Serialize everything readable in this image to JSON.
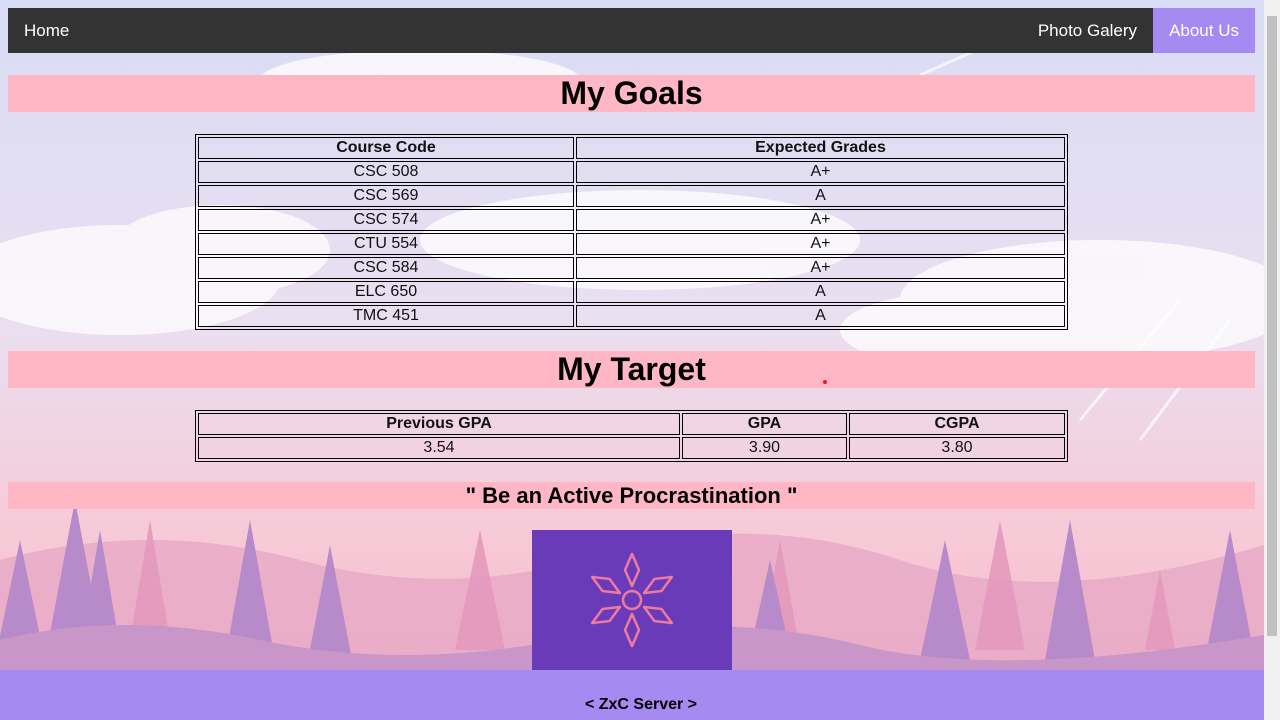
{
  "nav": {
    "home": "Home",
    "gallery": "Photo Galery",
    "about": "About Us"
  },
  "goals": {
    "title": "My Goals",
    "headers": [
      "Course Code",
      "Expected Grades"
    ],
    "rows": [
      [
        "CSC 508",
        "A+"
      ],
      [
        "CSC 569",
        "A"
      ],
      [
        "CSC 574",
        "A+"
      ],
      [
        "CTU 554",
        "A+"
      ],
      [
        "CSC 584",
        "A+"
      ],
      [
        "ELC 650",
        "A"
      ],
      [
        "TMC 451",
        "A"
      ]
    ]
  },
  "target": {
    "title": "My Target",
    "headers": [
      "Previous GPA",
      "GPA",
      "CGPA"
    ],
    "rows": [
      [
        "3.54",
        "3.90",
        "3.80"
      ]
    ]
  },
  "quote": "\" Be an Active Procrastination \"",
  "footer": {
    "text": "< ZxC Server >"
  },
  "colors": {
    "navbar": "#333333",
    "accent": "#a58af2",
    "heading_band": "#ffb7c5",
    "logo_bg": "#6a3bb8",
    "logo_line": "#f07aa0"
  },
  "logo_icon": "snowflake-star-icon"
}
